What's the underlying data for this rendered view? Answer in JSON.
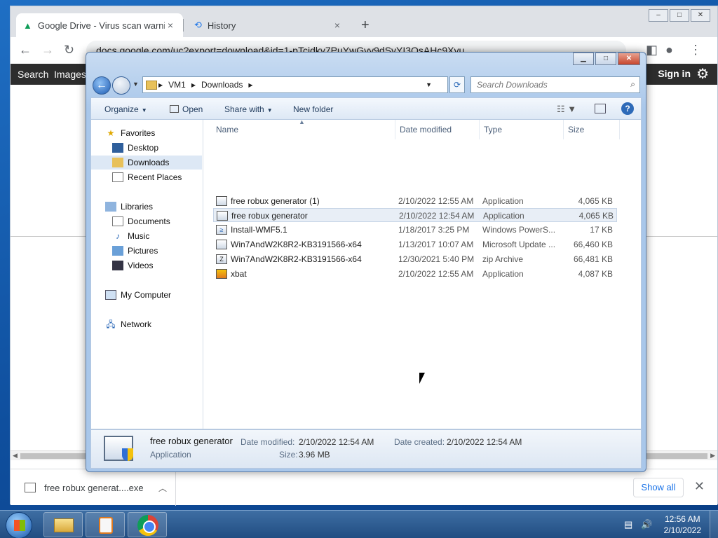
{
  "chrome": {
    "tabs": [
      {
        "label": "Google Drive - Virus scan warnin",
        "close": "×",
        "icon": "google-drive-icon"
      },
      {
        "label": "History",
        "close": "×",
        "icon": "history-icon"
      }
    ],
    "new_tab": "+",
    "window_buttons": [
      "–",
      "□",
      "✕"
    ],
    "url": "docs.google.com/uc?export=download&id=1-pTcjdky7PuYwGvy9dSyYI3OsAHc9Xyu",
    "google_bar": {
      "search": "Search",
      "images": "Images",
      "sign_in": "Sign in"
    },
    "download": {
      "filename": "free robux generat....exe",
      "show_all": "Show all"
    }
  },
  "explorer": {
    "breadcrumb": [
      "VM1",
      "Downloads"
    ],
    "search_placeholder": "Search Downloads",
    "commands": {
      "organize": "Organize",
      "open": "Open",
      "share_with": "Share with",
      "new_folder": "New folder"
    },
    "nav": {
      "favorites": "Favorites",
      "favorite_items": [
        "Desktop",
        "Downloads",
        "Recent Places"
      ],
      "libraries": "Libraries",
      "library_items": [
        "Documents",
        "Music",
        "Pictures",
        "Videos"
      ],
      "my_computer": "My Computer",
      "network": "Network"
    },
    "columns": {
      "name": "Name",
      "date": "Date modified",
      "type": "Type",
      "size": "Size"
    },
    "files": [
      {
        "name": "free robux generator (1)",
        "date": "2/10/2022 12:55 AM",
        "type": "Application",
        "size": "4,065 KB"
      },
      {
        "name": "free robux generator",
        "date": "2/10/2022 12:54 AM",
        "type": "Application",
        "size": "4,065 KB"
      },
      {
        "name": "Install-WMF5.1",
        "date": "1/18/2017 3:25 PM",
        "type": "Windows PowerS...",
        "size": "17 KB"
      },
      {
        "name": "Win7AndW2K8R2-KB3191566-x64",
        "date": "1/13/2017 10:07 AM",
        "type": "Microsoft Update ...",
        "size": "66,460 KB"
      },
      {
        "name": "Win7AndW2K8R2-KB3191566-x64",
        "date": "12/30/2021 5:40 PM",
        "type": "zip Archive",
        "size": "66,481 KB"
      },
      {
        "name": "xbat",
        "date": "2/10/2022 12:55 AM",
        "type": "Application",
        "size": "4,087 KB"
      }
    ],
    "selected_index": 1,
    "details": {
      "name": "free robux generator",
      "type": "Application",
      "date_modified_label": "Date modified:",
      "date_modified": "2/10/2022 12:54 AM",
      "date_created_label": "Date created:",
      "date_created": "2/10/2022 12:54 AM",
      "size_label": "Size:",
      "size": "3.96 MB"
    }
  },
  "taskbar": {
    "time": "12:56 AM",
    "date": "2/10/2022"
  },
  "colors": {
    "selection": "#dde8f5",
    "link": "#1a73e8",
    "taskbar": "#214d82"
  }
}
